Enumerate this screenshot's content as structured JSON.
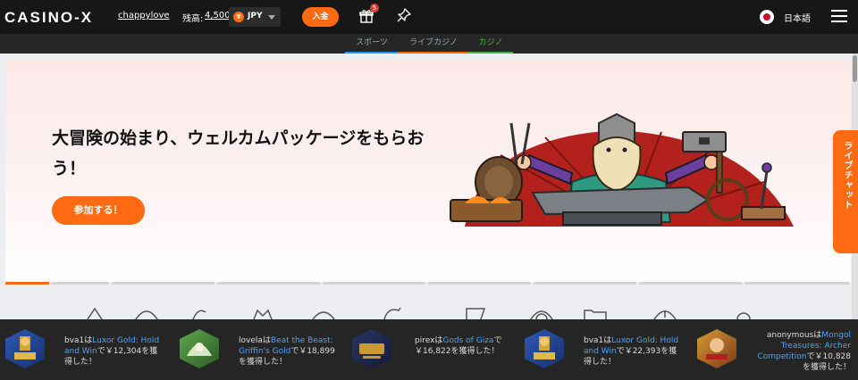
{
  "header": {
    "logo": "CASINO-X",
    "username": "chappylove",
    "balance_label": "残高:",
    "balance_value": "4,500",
    "currency_badge": "¥",
    "currency": "JPY",
    "deposit_label": "入金",
    "gift_count": "5",
    "language": "日本語"
  },
  "subnav": {
    "tabs": [
      {
        "label": "スポーツ"
      },
      {
        "label": "ライブカジノ"
      },
      {
        "label": "カジノ"
      }
    ]
  },
  "hero": {
    "title": "大冒険の始まり、ウェルカムパッケージをもらおう！",
    "cta_label": "参加する！"
  },
  "live_chat_label": "ライブチャット",
  "wins": [
    {
      "user": "bva1",
      "particle": "は",
      "game": "Luxor Gold: Hold and Win",
      "amount_text": "で￥12,304を獲得した！"
    },
    {
      "user": "lovela",
      "particle": "は",
      "game": "Beat the Beast: Griffin's Gold",
      "amount_text": "で￥18,899を獲得した！"
    },
    {
      "user": "pirex",
      "particle": "は",
      "game": "Gods of Giza",
      "amount_text": "で￥16,822を獲得した！"
    },
    {
      "user": "bva1",
      "particle": "は",
      "game": "Luxor Gold: Hold and Win",
      "amount_text": "で￥22,393を獲得した！"
    },
    {
      "user": "anonymous",
      "particle": "は",
      "game": "Mongol Treasures: Archer Competition",
      "amount_text": "で￥10,828を獲得した！"
    }
  ],
  "colors": {
    "accent": "#ff6a13",
    "topbar": "#171717",
    "ticker": "#252525",
    "link": "#4aa3ff"
  }
}
